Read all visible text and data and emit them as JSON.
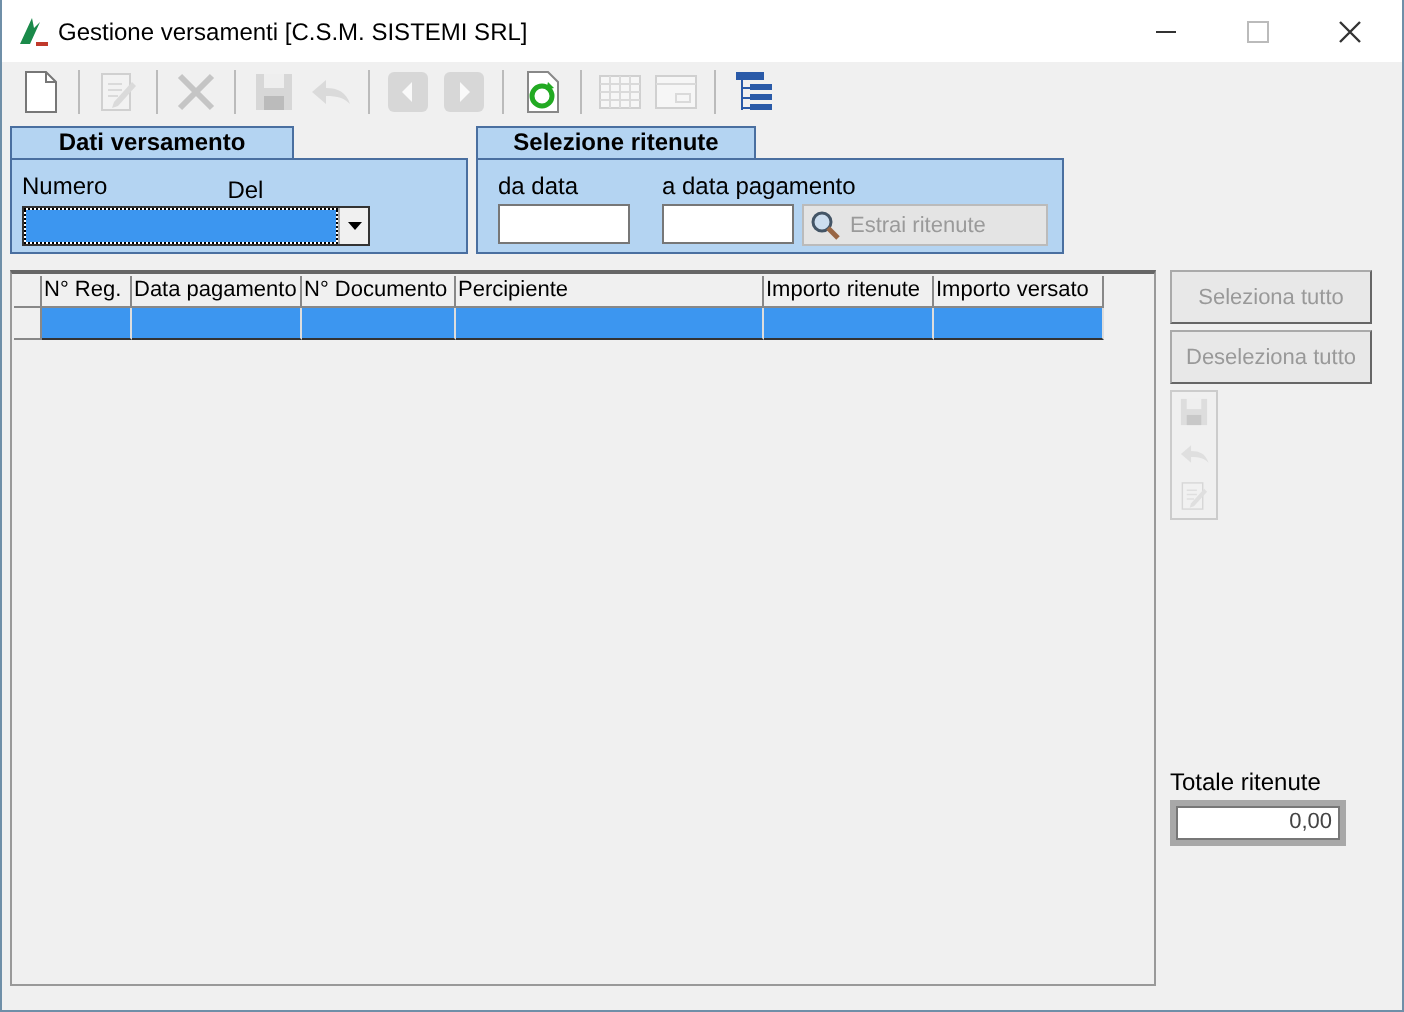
{
  "window": {
    "title": "Gestione versamenti [C.S.M. SISTEMI SRL]"
  },
  "toolbar_groups": [
    [
      {
        "kind": "new",
        "disabled": false
      }
    ],
    [
      {
        "kind": "edit",
        "disabled": true
      }
    ],
    [
      {
        "kind": "delete",
        "disabled": true
      }
    ],
    [
      {
        "kind": "save",
        "disabled": true
      },
      {
        "kind": "undo",
        "disabled": true
      }
    ],
    [
      {
        "kind": "prev",
        "disabled": true
      },
      {
        "kind": "next",
        "disabled": true
      }
    ],
    [
      {
        "kind": "refresh",
        "disabled": false
      }
    ],
    [
      {
        "kind": "grid",
        "disabled": true
      },
      {
        "kind": "form",
        "disabled": true
      }
    ],
    [
      {
        "kind": "tree",
        "disabled": false
      }
    ]
  ],
  "dati_versamento": {
    "title": "Dati versamento",
    "numero_label": "Numero",
    "del_label": "Del",
    "combo": {
      "focused": true
    }
  },
  "selezione_ritenute": {
    "title": "Selezione ritenute",
    "da_data_label": "da data",
    "a_data_label": "a data pagamento",
    "button": {
      "label": "Estrai ritenute",
      "disabled": true
    }
  },
  "table": {
    "columns": [
      "N° Reg.",
      "Data pagamento",
      "N° Documento",
      "Percipiente",
      "Importo ritenute",
      "Importo versato"
    ],
    "rows": [
      {
        "selected": true
      }
    ]
  },
  "side_buttons": [
    {
      "label": "Seleziona tutto",
      "disabled": true
    },
    {
      "label": "Deseleziona tutto",
      "disabled": true
    }
  ],
  "side_tools": [
    {
      "kind": "save",
      "disabled": true
    },
    {
      "kind": "undo",
      "disabled": true
    },
    {
      "kind": "edit",
      "disabled": true
    }
  ],
  "totale": {
    "label": "Totale ritenute",
    "value": "0,00"
  }
}
